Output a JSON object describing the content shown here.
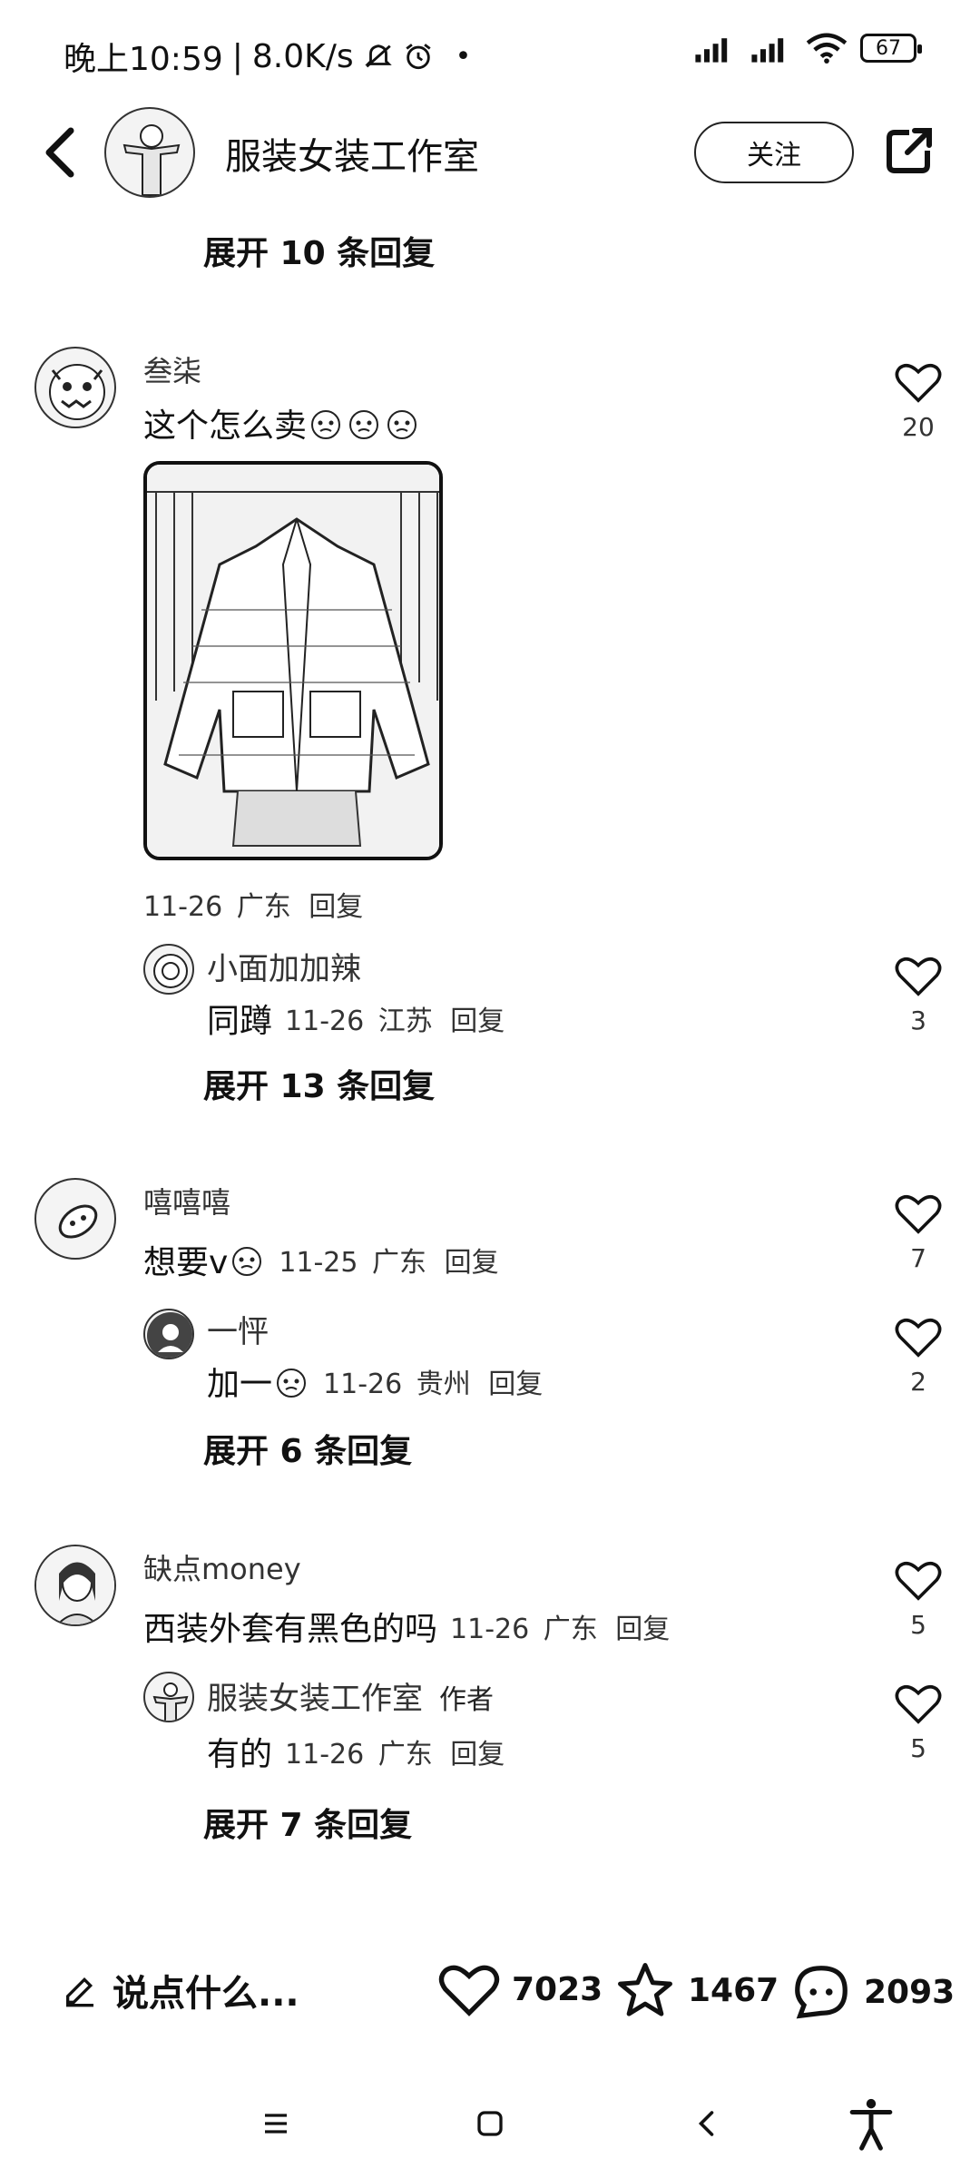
{
  "status_bar": {
    "time": "晚上10:59",
    "speed": "8.0K/s",
    "battery": "67"
  },
  "header": {
    "title": "服装女装工作室",
    "follow_label": "关注"
  },
  "expand_top": "展开 10 条回复",
  "comments": [
    {
      "username": "叁柒",
      "text": "这个怎么卖",
      "likes": "20",
      "date": "11-26",
      "location": "广东",
      "reply_label": "回复",
      "reply": {
        "username": "小面加加辣",
        "text": "同蹲",
        "date": "11-26",
        "location": "江苏",
        "reply_label": "回复",
        "likes": "3"
      },
      "expand": "展开 13 条回复"
    },
    {
      "username": "嘻嘻嘻",
      "text": "想要v",
      "likes": "7",
      "date": "11-25",
      "location": "广东",
      "reply_label": "回复",
      "reply": {
        "username": "一怦",
        "text": "加一",
        "date": "11-26",
        "location": "贵州",
        "reply_label": "回复",
        "likes": "2"
      },
      "expand": "展开 6 条回复"
    },
    {
      "username": "缺点money",
      "text": "西装外套有黑色的吗",
      "likes": "5",
      "date": "11-26",
      "location": "广东",
      "reply_label": "回复",
      "reply": {
        "username": "服装女装工作室",
        "author_tag": "作者",
        "text": "有的",
        "date": "11-26",
        "location": "广东",
        "reply_label": "回复",
        "likes": "5"
      },
      "expand": "展开 7 条回复"
    }
  ],
  "bottom_bar": {
    "compose_placeholder": "说点什么...",
    "likes": "7023",
    "favorites": "1467",
    "comments": "2093"
  },
  "icons": [
    "back-icon",
    "share-icon",
    "heart-icon",
    "star-icon",
    "comment-icon",
    "pencil-icon",
    "menu-icon",
    "home-icon",
    "nav-back-icon",
    "accessibility-icon"
  ]
}
